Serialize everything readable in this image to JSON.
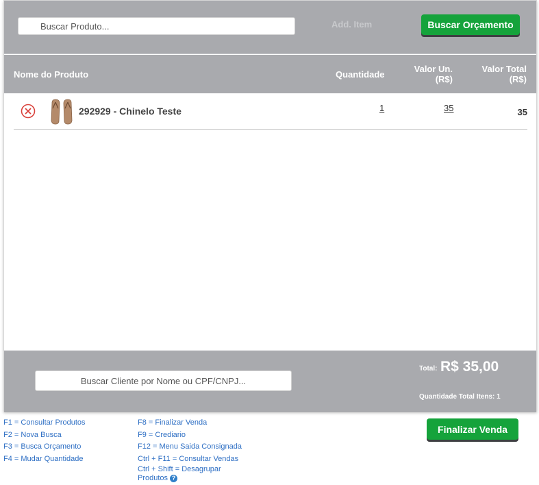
{
  "toolbar": {
    "search_placeholder": "Buscar Produto...",
    "add_item_label": "Add. Item",
    "buscar_orcamento_label": "Buscar Orçamento"
  },
  "table": {
    "headers": {
      "name": "Nome do Produto",
      "quantity": "Quantidade",
      "unit_value": "Valor Un.",
      "unit_value_currency": "(R$)",
      "total_value": "Valor Total",
      "total_value_currency": "(R$)"
    },
    "rows": [
      {
        "name": "292929 - Chinelo Teste",
        "quantity": "1",
        "unit_value": "35",
        "total_value": "35"
      }
    ]
  },
  "footer": {
    "client_search_placeholder": "Buscar Cliente por Nome ou CPF/CNPJ...",
    "total_label": "Total:",
    "total_value": "R$ 35,00",
    "quantity_total_label": "Quantidade Total Itens: 1"
  },
  "shortcuts": {
    "col1": [
      "F1 = Consultar Produtos",
      "F2 = Nova Busca",
      "F3 = Busca Orçamento",
      "F4 = Mudar Quantidade"
    ],
    "col2": [
      "F8 = Finalizar Venda",
      "F9 = Crediario",
      "F12 = Menu Saida Consignada",
      "Ctrl + F11 = Consultar Vendas",
      "Ctrl + Shift = Desagrupar",
      "Produtos"
    ],
    "help_icon_label": "?"
  },
  "actions": {
    "finalizar_venda_label": "Finalizar Venda"
  },
  "colors": {
    "bar_gray": "#a9aaae",
    "green": "#15a33b",
    "link_blue": "#2e6fc4",
    "remove_red": "#d9403a"
  },
  "icons": {
    "remove": "remove-circle-x-icon",
    "help": "help-circle-icon"
  }
}
